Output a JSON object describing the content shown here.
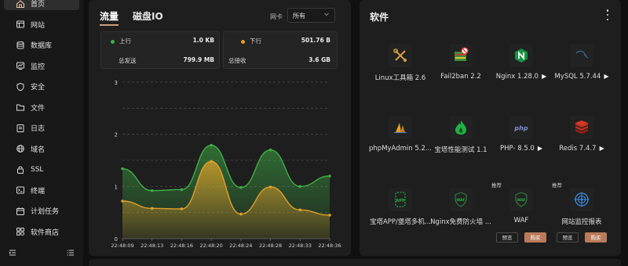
{
  "sidebar": {
    "items": [
      {
        "label": "首页",
        "icon": "home-icon",
        "active": true
      },
      {
        "label": "网站",
        "icon": "website-icon"
      },
      {
        "label": "数据库",
        "icon": "database-icon"
      },
      {
        "label": "监控",
        "icon": "monitor-icon"
      },
      {
        "label": "安全",
        "icon": "shield-icon"
      },
      {
        "label": "文件",
        "icon": "folder-icon"
      },
      {
        "label": "日志",
        "icon": "log-icon"
      },
      {
        "label": "域名",
        "icon": "globe-icon"
      },
      {
        "label": "SSL",
        "icon": "ssl-icon"
      },
      {
        "label": "终端",
        "icon": "terminal-icon"
      },
      {
        "label": "计划任务",
        "icon": "calendar-icon"
      },
      {
        "label": "软件商店",
        "icon": "store-icon"
      }
    ]
  },
  "traffic": {
    "tabs": [
      "流量",
      "磁盘IO"
    ],
    "nic_label": "网卡",
    "nic_value": "所有",
    "up_label": "上行",
    "up_value": "1.0 KB",
    "down_label": "下行",
    "down_value": "501.76 B",
    "total_sent_label": "总发送",
    "total_sent_value": "799.9 MB",
    "total_recv_label": "总接收",
    "total_recv_value": "3.6 GB"
  },
  "chart_data": {
    "type": "area",
    "x": [
      "22:48:09",
      "22:48:13",
      "22:48:16",
      "22:48:20",
      "22:48:24",
      "22:48:28",
      "22:48:33",
      "22:48:36"
    ],
    "ylim": [
      0,
      3
    ],
    "yticks": [
      0,
      0.5,
      1,
      1.5,
      2,
      2.5,
      3
    ],
    "ytick_labels": [
      "0",
      "",
      "1",
      "",
      "2",
      "",
      "3"
    ],
    "grid": true,
    "colors": {
      "up": "#3fae45",
      "down": "#e0a029"
    },
    "series": [
      {
        "key": "up",
        "values": [
          1.34,
          0.92,
          0.94,
          1.79,
          0.98,
          1.7,
          1.0,
          1.2
        ]
      },
      {
        "key": "down",
        "values": [
          0.72,
          0.58,
          0.57,
          1.48,
          0.47,
          0.99,
          0.55,
          0.45
        ]
      }
    ]
  },
  "software": {
    "title": "软件",
    "apps": [
      {
        "name": "Linux工具箱 2.6",
        "icon": "tools-icon",
        "play": false
      },
      {
        "name": "Fail2ban 2.2",
        "icon": "fail2ban-icon",
        "play": false
      },
      {
        "name": "Nginx 1.28.0",
        "icon": "nginx-icon",
        "play": true
      },
      {
        "name": "MySQL 5.7.44",
        "icon": "mysql-icon",
        "play": true
      },
      {
        "name": "phpMyAdmin 5.2...",
        "icon": "phpmyadmin-icon",
        "play": false
      },
      {
        "name": "宝塔性能测试 1.1",
        "icon": "benchmark-icon",
        "play": false
      },
      {
        "name": "PHP- 8.5.0",
        "icon": "php-icon",
        "play": true
      },
      {
        "name": "Redis 7.4.7",
        "icon": "redis-icon",
        "play": true
      },
      {
        "name": "宝塔APP/堡塔多机...",
        "icon": "app-icon",
        "play": false
      },
      {
        "name": "Nginx免费防火墙 ...",
        "icon": "waf-shield-icon",
        "play": false
      },
      {
        "name": "WAF",
        "icon": "waf-icon",
        "play": false,
        "badge": "推荐",
        "preview": "预览",
        "buy": "购买"
      },
      {
        "name": "网站监控报表",
        "icon": "site-monitor-icon",
        "play": false,
        "badge": "推荐",
        "preview": "预览",
        "buy": "购买"
      }
    ]
  }
}
